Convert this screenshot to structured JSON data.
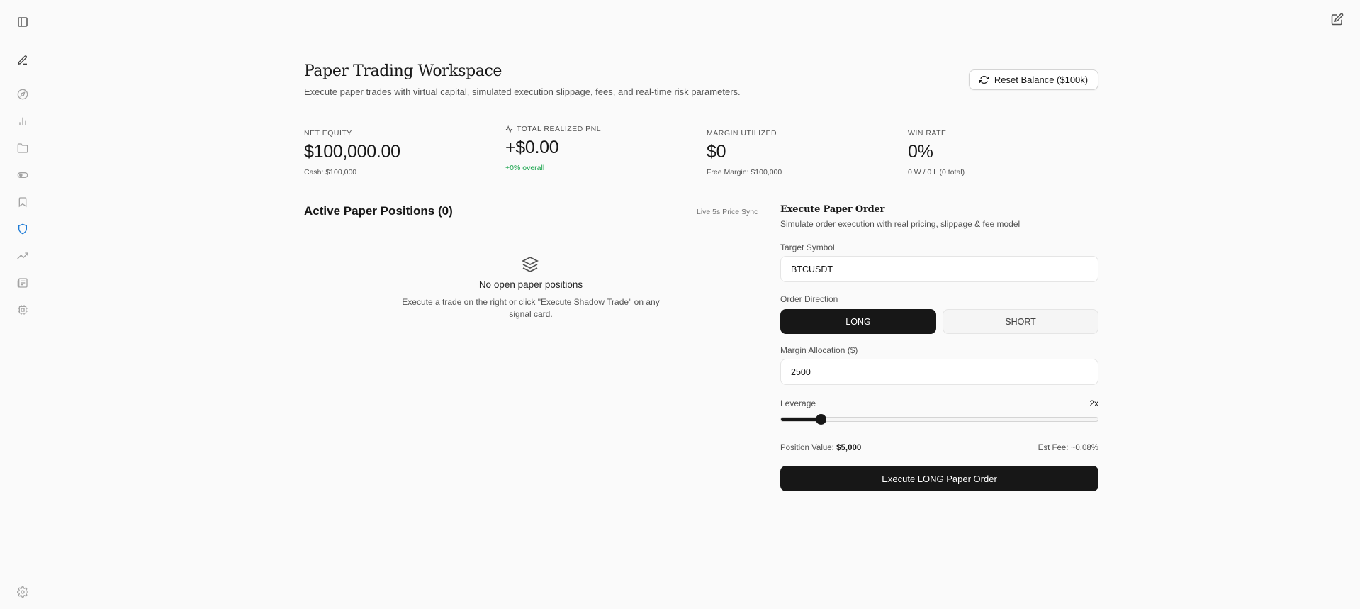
{
  "header": {
    "title": "Paper Trading Workspace",
    "subtitle": "Execute paper trades with virtual capital, simulated execution slippage, fees, and real-time risk parameters.",
    "reset_label": "Reset Balance ($100k)"
  },
  "stats": [
    {
      "label": "NET EQUITY",
      "value": "$100,000.00",
      "sub": "Cash: $100,000"
    },
    {
      "label": "TOTAL REALIZED PNL",
      "value": "+$0.00",
      "sub": "+0% overall"
    },
    {
      "label": "MARGIN UTILIZED",
      "value": "$0",
      "sub": "Free Margin: $100,000"
    },
    {
      "label": "WIN RATE",
      "value": "0%",
      "sub": "0 W / 0 L (0 total)"
    }
  ],
  "positions": {
    "title": "Active Paper Positions (0)",
    "sync_label": "Live 5s Price Sync",
    "empty_title": "No open paper positions",
    "empty_desc": "Execute a trade on the right or click \"Execute Shadow Trade\" on any signal card."
  },
  "order": {
    "title": "Execute Paper Order",
    "subtitle": "Simulate order execution with real pricing, slippage & fee model",
    "symbol_label": "Target Symbol",
    "symbol_value": "BTCUSDT",
    "direction_label": "Order Direction",
    "long_label": "LONG",
    "short_label": "SHORT",
    "margin_label": "Margin Allocation ($)",
    "margin_value": "2500",
    "leverage_label": "Leverage",
    "leverage_value": "2x",
    "leverage_fraction": 0.125,
    "position_value_label": "Position Value:",
    "position_value": "$5,000",
    "est_fee": "Est Fee: ~0.08%",
    "execute_label": "Execute LONG Paper Order"
  },
  "colors": {
    "accent_active": "#1d7bd6",
    "primary_dark": "#171717",
    "positive": "#16a34a"
  },
  "icons": {
    "sidebar": [
      "sidebar-toggle-icon",
      "new-chat-icon",
      "compass-icon",
      "bar-chart-icon",
      "folder-icon",
      "toggle-dot-icon",
      "bookmark-icon",
      "shield-icon",
      "trending-up-icon",
      "newspaper-icon",
      "cpu-icon",
      "settings-icon"
    ],
    "top_right": "edit-icon"
  }
}
